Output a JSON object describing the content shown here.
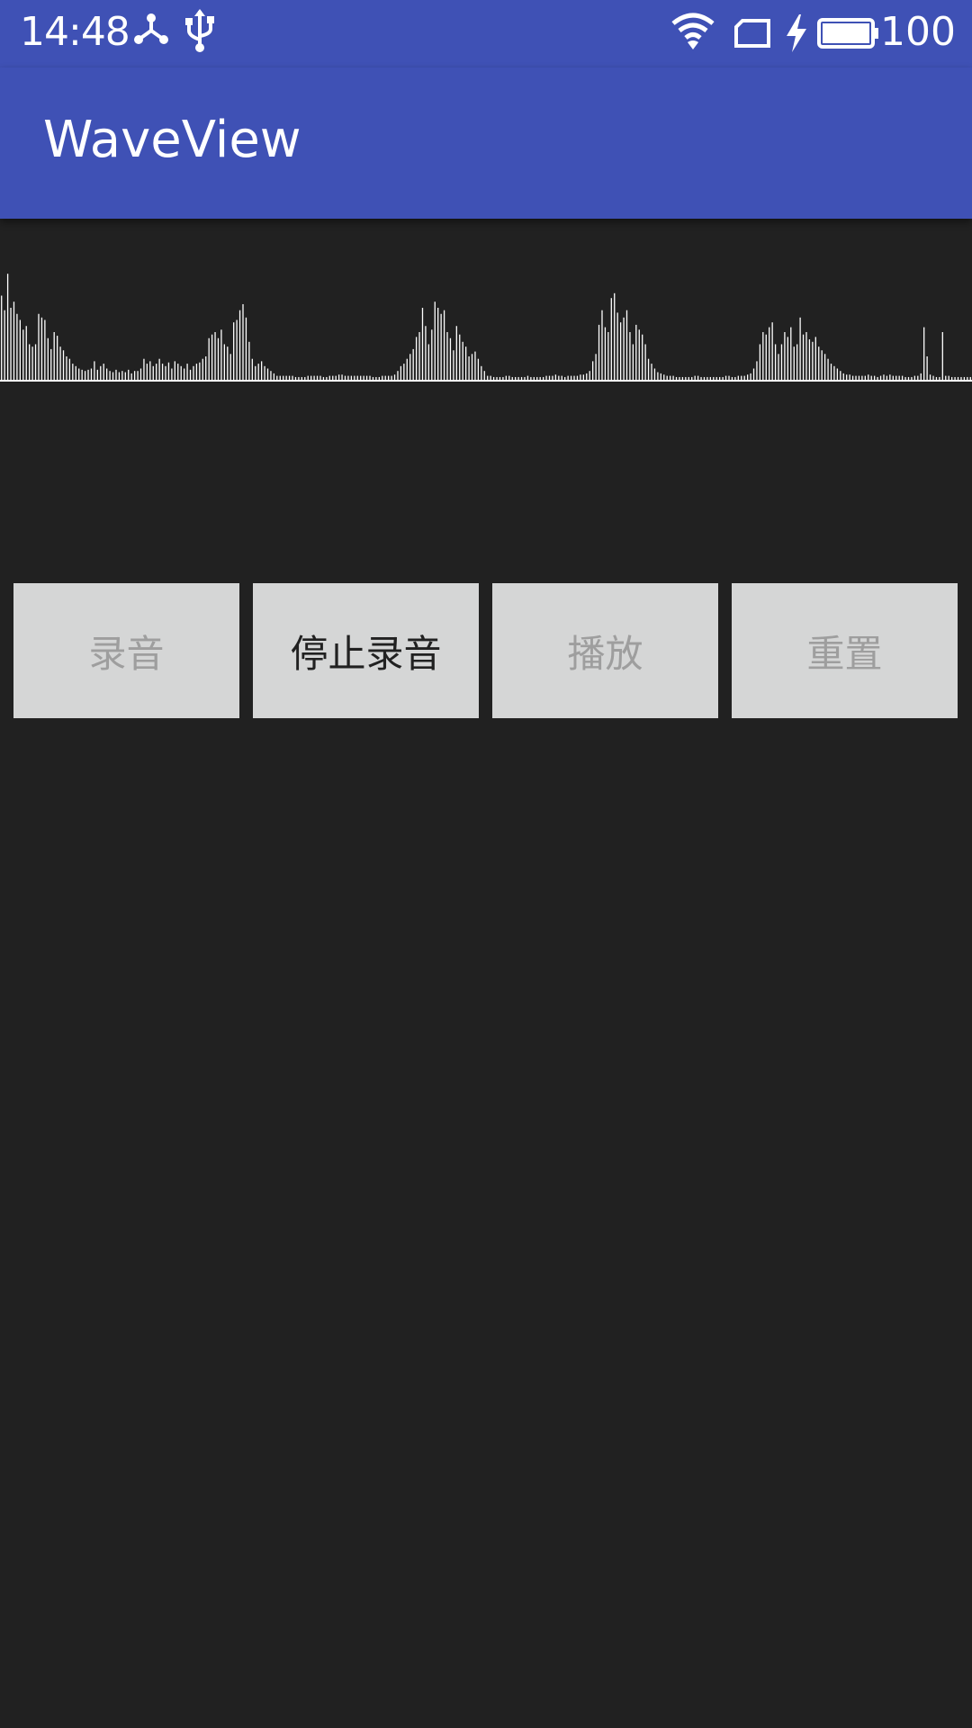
{
  "status_bar": {
    "time": "14:48",
    "icons": [
      "share-icon",
      "usb-icon",
      "wifi-icon",
      "sim-card-icon",
      "charging-bolt-icon",
      "battery-icon"
    ],
    "battery_level": "100"
  },
  "app_bar": {
    "title": "WaveView"
  },
  "waveform": {
    "color": "#ffffff",
    "amplitudes": [
      70,
      58,
      88,
      60,
      65,
      55,
      50,
      42,
      45,
      30,
      28,
      30,
      55,
      52,
      50,
      35,
      26,
      40,
      37,
      28,
      25,
      20,
      18,
      14,
      12,
      10,
      9,
      8,
      9,
      10,
      16,
      9,
      12,
      14,
      10,
      8,
      7,
      9,
      7,
      8,
      7,
      9,
      6,
      8,
      8,
      10,
      18,
      14,
      16,
      12,
      14,
      18,
      14,
      12,
      15,
      10,
      16,
      14,
      12,
      10,
      14,
      9,
      12,
      14,
      15,
      18,
      20,
      35,
      38,
      40,
      35,
      42,
      30,
      28,
      22,
      48,
      50,
      58,
      63,
      52,
      32,
      18,
      12,
      14,
      16,
      12,
      10,
      8,
      6,
      4,
      4,
      4,
      4,
      4,
      4,
      3,
      3,
      3,
      3,
      4,
      4,
      4,
      4,
      4,
      3,
      3,
      4,
      4,
      4,
      5,
      5,
      4,
      4,
      4,
      4,
      4,
      4,
      4,
      4,
      4,
      3,
      3,
      3,
      4,
      4,
      4,
      4,
      5,
      8,
      12,
      14,
      18,
      22,
      26,
      36,
      40,
      60,
      45,
      30,
      42,
      65,
      60,
      55,
      58,
      40,
      35,
      25,
      45,
      38,
      32,
      28,
      20,
      22,
      24,
      18,
      12,
      8,
      4,
      4,
      3,
      3,
      3,
      3,
      4,
      4,
      3,
      3,
      3,
      3,
      3,
      4,
      3,
      3,
      3,
      3,
      3,
      4,
      4,
      4,
      5,
      4,
      4,
      3,
      4,
      4,
      4,
      4,
      5,
      5,
      6,
      8,
      16,
      22,
      46,
      58,
      44,
      40,
      68,
      72,
      56,
      48,
      52,
      58,
      40,
      30,
      46,
      42,
      38,
      30,
      18,
      14,
      10,
      7,
      6,
      5,
      4,
      4,
      4,
      3,
      3,
      3,
      3,
      3,
      3,
      4,
      4,
      3,
      3,
      3,
      3,
      3,
      3,
      3,
      3,
      4,
      4,
      3,
      3,
      4,
      4,
      4,
      5,
      6,
      10,
      16,
      30,
      40,
      38,
      44,
      48,
      30,
      22,
      30,
      40,
      36,
      44,
      28,
      30,
      52,
      38,
      40,
      34,
      32,
      36,
      28,
      25,
      22,
      18,
      14,
      12,
      10,
      8,
      6,
      5,
      5,
      4,
      4,
      4,
      4,
      4,
      5,
      4,
      4,
      3,
      4,
      5,
      4,
      5,
      4,
      4,
      4,
      4,
      3,
      3,
      3,
      4,
      4,
      6,
      44,
      20,
      5,
      4,
      3,
      3,
      40,
      4,
      4,
      3,
      3,
      3,
      3,
      3,
      3,
      3
    ]
  },
  "buttons": [
    {
      "label": "录音",
      "enabled": false
    },
    {
      "label": "停止录音",
      "enabled": true
    },
    {
      "label": "播放",
      "enabled": false
    },
    {
      "label": "重置",
      "enabled": false
    }
  ]
}
